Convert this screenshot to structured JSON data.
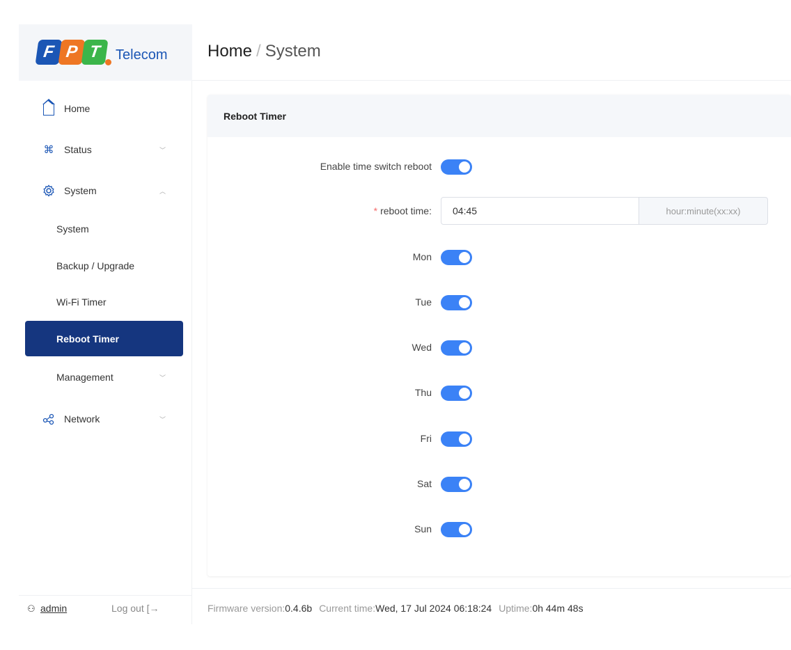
{
  "logo": {
    "letters": [
      "F",
      "P",
      "T"
    ],
    "text": "Telecom",
    "colors": {
      "f": "#1b56b5",
      "p": "#ee7623",
      "t": "#3bb54a"
    }
  },
  "breadcrumb": {
    "home": "Home",
    "separator": "/",
    "current": "System"
  },
  "sidebar": {
    "items": [
      {
        "label": "Home",
        "icon": "home-icon"
      },
      {
        "label": "Status",
        "icon": "command-icon",
        "chevron": "chevron-down-icon"
      },
      {
        "label": "System",
        "icon": "settings-icon",
        "chevron": "chevron-up-icon"
      },
      {
        "label": "Network",
        "icon": "share-icon",
        "chevron": "chevron-down-icon"
      }
    ],
    "sub_items": [
      {
        "label": "System"
      },
      {
        "label": "Backup / Upgrade"
      },
      {
        "label": "Wi-Fi Timer"
      },
      {
        "label": "Reboot Timer",
        "active": true
      },
      {
        "label": "Management",
        "chevron": "chevron-down-icon"
      }
    ]
  },
  "card": {
    "title": "Reboot Timer",
    "enable_label": "Enable time switch reboot",
    "enable_on": true,
    "time_label": "reboot time:",
    "required_mark": "*",
    "time_value": "04:45",
    "time_suffix": "hour:minute(xx:xx)",
    "days": [
      {
        "label": "Mon",
        "on": true
      },
      {
        "label": "Tue",
        "on": true
      },
      {
        "label": "Wed",
        "on": true
      },
      {
        "label": "Thu",
        "on": true
      },
      {
        "label": "Fri",
        "on": true
      },
      {
        "label": "Sat",
        "on": true
      },
      {
        "label": "Sun",
        "on": true
      }
    ]
  },
  "user": {
    "name": "admin",
    "logout": "Log out"
  },
  "footer": {
    "firmware_label": "Firmware version:",
    "firmware_value": "0.4.6b",
    "time_label": "Current time:",
    "time_value": "Wed, 17 Jul 2024 06:18:24",
    "uptime_label": "Uptime:",
    "uptime_value": "0h 44m 48s"
  },
  "colors": {
    "accent": "#3b82f6",
    "active_nav": "#15367f",
    "brand": "#1b56b5"
  }
}
